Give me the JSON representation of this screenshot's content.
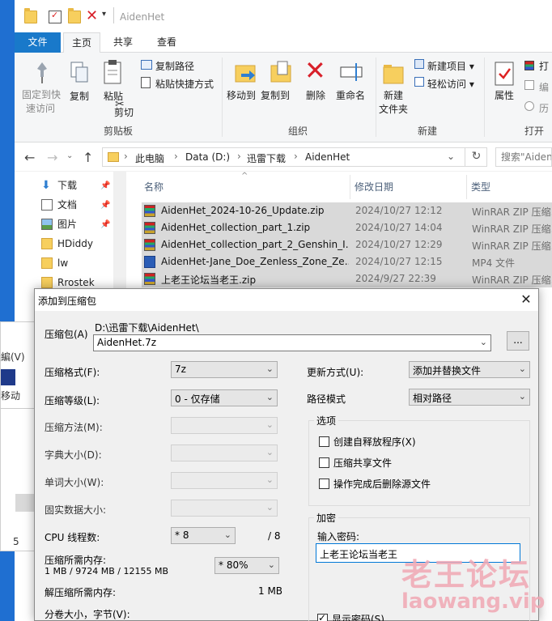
{
  "explorer": {
    "title": "AidenHet",
    "tabs": {
      "file": "文件",
      "home": "主页",
      "share": "共享",
      "view": "查看"
    },
    "ribbon": {
      "pin_quick_access": [
        "固定到快",
        "速访问"
      ],
      "copy": "复制",
      "paste": "粘贴",
      "copy_path": "复制路径",
      "paste_shortcut": "粘贴快捷方式",
      "cut": "剪切",
      "clipboard_group": "剪贴板",
      "move_to": "移动到",
      "copy_to": "复制到",
      "delete": "删除",
      "rename": "重命名",
      "organize_group": "组织",
      "new_item": "新建项目",
      "easy_access": "轻松访问",
      "new_folder": [
        "新建",
        "文件夹"
      ],
      "new_group": "新建",
      "properties": "属性",
      "open_group": "打开",
      "open_partial": "打",
      "edit_partial": "编",
      "history_partial": "历"
    },
    "address": {
      "crumbs": [
        "此电脑",
        "Data (D:)",
        "迅雷下载",
        "AidenHet"
      ],
      "search_placeholder": "搜索\"AidenH"
    },
    "nav_items": [
      {
        "label": "下载",
        "icon": "download-icon",
        "pinned": true
      },
      {
        "label": "文档",
        "icon": "document-icon",
        "pinned": true
      },
      {
        "label": "图片",
        "icon": "picture-icon",
        "pinned": true
      },
      {
        "label": "HDiddy",
        "icon": "folder-icon",
        "pinned": false
      },
      {
        "label": "lw",
        "icon": "folder-icon",
        "pinned": false
      },
      {
        "label": "Rrostek",
        "icon": "folder-icon",
        "pinned": false
      }
    ],
    "columns": {
      "name": "名称",
      "date": "修改日期",
      "type": "类型"
    },
    "files": [
      {
        "name": "AidenHet_2024-10-26_Update.zip",
        "date": "2024/10/27 12:12",
        "type": "WinRAR ZIP 压缩...",
        "icon": "zip"
      },
      {
        "name": "AidenHet_collection_part_1.zip",
        "date": "2024/10/27 14:04",
        "type": "WinRAR ZIP 压缩...",
        "icon": "zip"
      },
      {
        "name": "AidenHet_collection_part_2_Genshin_I...",
        "date": "2024/10/27 12:29",
        "type": "WinRAR ZIP 压缩...",
        "icon": "zip"
      },
      {
        "name": "AidenHet-Jane_Doe_Zenless_Zone_Ze...",
        "date": "2024/10/27 12:15",
        "type": "MP4 文件",
        "icon": "mp4"
      },
      {
        "name": "上老王论坛当老王.zip",
        "date": "2024/9/27 22:39",
        "type": "WinRAR ZIP 压缩...",
        "icon": "zip"
      }
    ],
    "left_remnants": {
      "r1": "編(V)",
      "r2": "移动",
      "r3": "5"
    }
  },
  "dialog": {
    "title": "添加到压缩包",
    "archive_label": "压缩包(A)",
    "archive_dir": "D:\\迅雷下载\\AidenHet\\",
    "archive_name": "AidenHet.7z",
    "browse": "...",
    "format_label": "压缩格式(F):",
    "format_value": "7z",
    "level_label": "压缩等级(L):",
    "level_value": "0 - 仅存储",
    "method_label": "压缩方法(M):",
    "dict_label": "字典大小(D):",
    "word_label": "单词大小(W):",
    "solid_label": "固实数据大小:",
    "cpu_label": "CPU 线程数:",
    "cpu_value": "* 8",
    "cpu_total": "/ 8",
    "mem_label": "压缩所需内存:",
    "mem_detail": "1 MB / 9724 MB / 12155 MB",
    "mem_value": "* 80%",
    "decomp_label": "解压缩所需内存:",
    "decomp_value": "1 MB",
    "split_label": "分卷大小，字节(V):",
    "update_label": "更新方式(U):",
    "update_value": "添加并替换文件",
    "path_label": "路径模式",
    "path_value": "相对路径",
    "options_title": "选项",
    "opt_sfx": "创建自释放程序(X)",
    "opt_shared": "压缩共享文件",
    "opt_delete": "操作完成后删除源文件",
    "encrypt_title": "加密",
    "password_label": "输入密码:",
    "password_value": "上老王论坛当老王",
    "show_password": "显示密码(S)",
    "close": "✕"
  },
  "watermark": {
    "cn": "老王论坛",
    "en": "laowang.vip"
  }
}
